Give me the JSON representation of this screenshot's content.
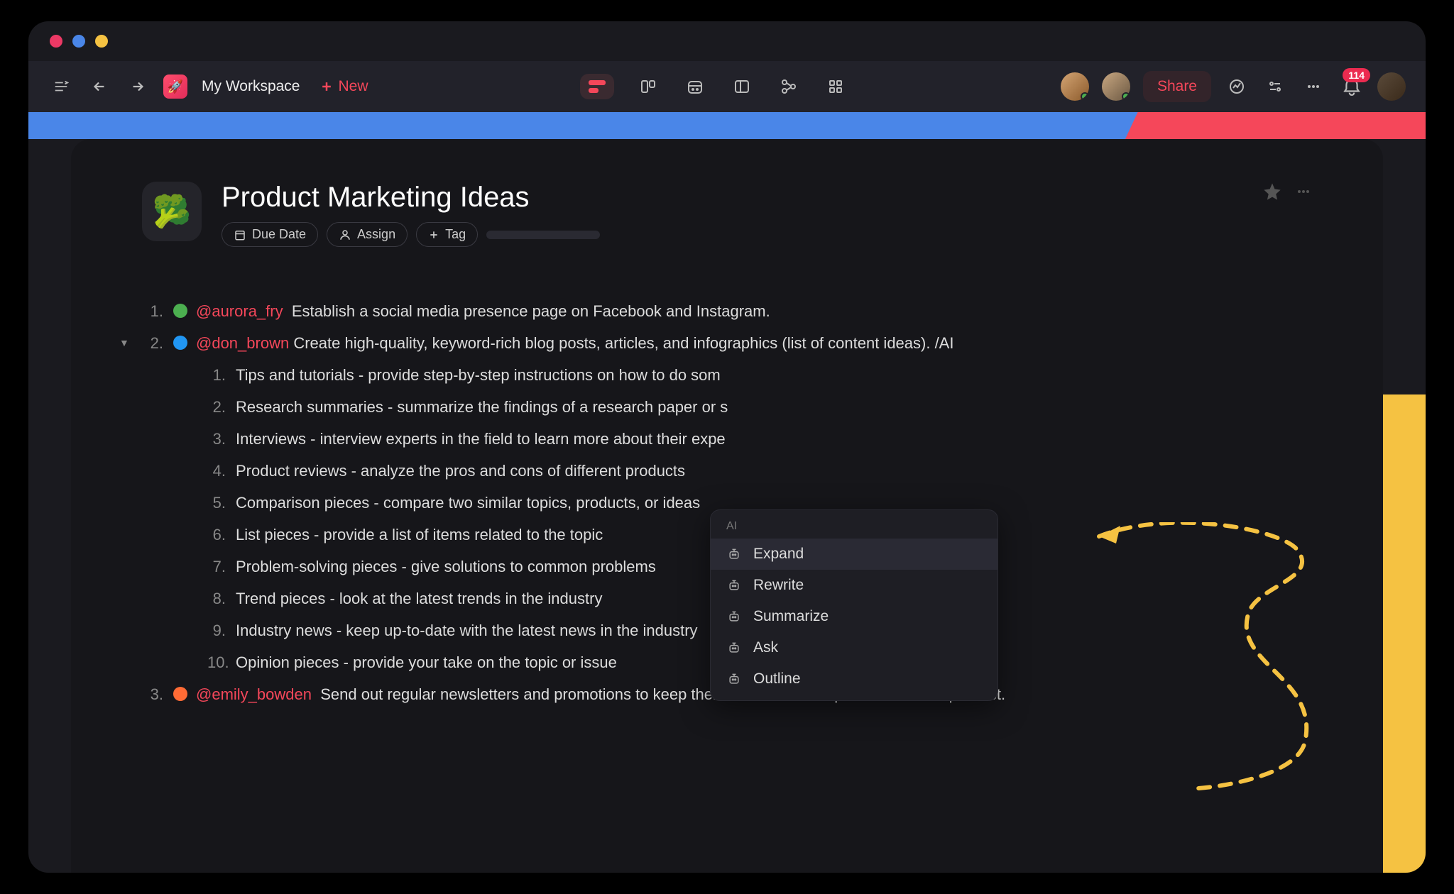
{
  "app": {
    "workspace": "My Workspace",
    "new_label": "New",
    "share_label": "Share",
    "notification_count": "114"
  },
  "doc": {
    "icon": "🥦",
    "title": "Product Marketing Ideas",
    "meta": {
      "due_date": "Due Date",
      "assign": "Assign",
      "tag": "Tag"
    }
  },
  "items": [
    {
      "num": "1.",
      "color": "green",
      "mention": "@aurora_fry",
      "text": "Establish a social media presence page on Facebook and Instagram."
    },
    {
      "num": "2.",
      "color": "blue",
      "mention": "@don_brown",
      "text": "Create high-quality, keyword-rich blog posts, articles, and infographics (list of content ideas). /AI",
      "children": [
        {
          "num": "1.",
          "text": "Tips and tutorials - provide step-by-step instructions on how to do som"
        },
        {
          "num": "2.",
          "text": "Research summaries - summarize the findings of a research paper or s"
        },
        {
          "num": "3.",
          "text": "Interviews - interview experts in the field to learn more about their expe"
        },
        {
          "num": "4.",
          "text": "Product reviews - analyze the pros and cons of different products"
        },
        {
          "num": "5.",
          "text": "Comparison pieces - compare two similar topics, products, or ideas"
        },
        {
          "num": "6.",
          "text": "List pieces - provide a list of items related to the topic"
        },
        {
          "num": "7.",
          "text": "Problem-solving pieces - give solutions to common problems"
        },
        {
          "num": "8.",
          "text": "Trend pieces - look at the latest trends in the industry"
        },
        {
          "num": "9.",
          "text": "Industry news - keep up-to-date with the latest news in the industry"
        },
        {
          "num": "10.",
          "text": "Opinion pieces - provide your take on the topic or issue"
        }
      ]
    },
    {
      "num": "3.",
      "color": "orange",
      "mention": "@emily_bowden",
      "text": "Send out regular newsletters and promotions to keep them informed and up-to-date on the product."
    }
  ],
  "ai_menu": {
    "header": "AI",
    "items": [
      "Expand",
      "Rewrite",
      "Summarize",
      "Ask",
      "Outline"
    ]
  }
}
